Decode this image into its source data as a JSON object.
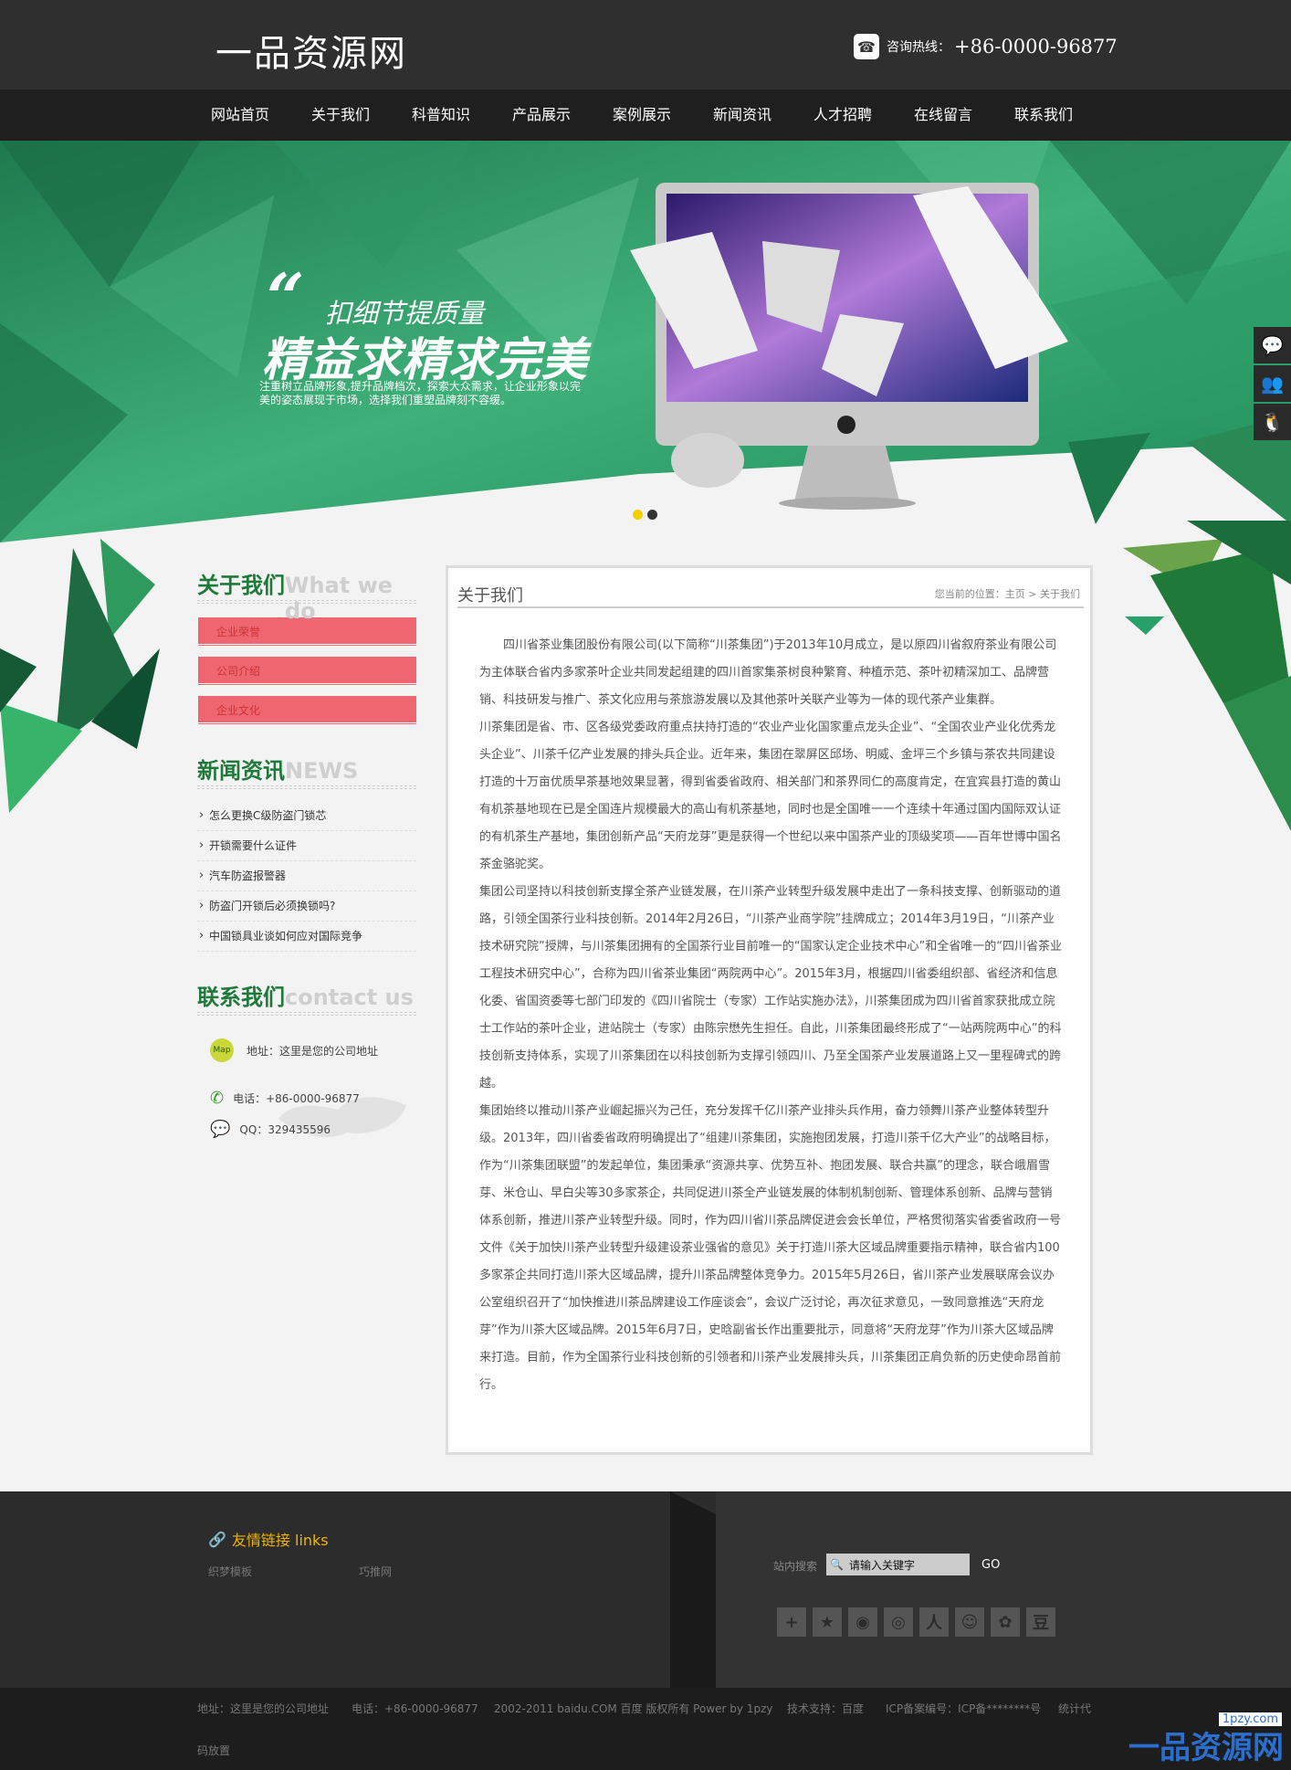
{
  "header": {
    "logo": "一品资源网",
    "hotline_label": "咨询热线：",
    "hotline_number": "+86-0000-96877"
  },
  "nav": [
    "网站首页",
    "关于我们",
    "科普知识",
    "产品展示",
    "案例展示",
    "新闻资讯",
    "人才招聘",
    "在线留言",
    "联系我们"
  ],
  "banner": {
    "quote": "“",
    "slogan_small": "扣细节提质量",
    "slogan_big": "精益求精求完美",
    "desc": "注重树立品牌形象,提升品牌档次，探索大众需求，让企业形象以完美的姿态展现于市场，选择我们重塑品牌刻不容缓。"
  },
  "sidebar": {
    "about": {
      "title": "关于我们",
      "title_en": "What we do",
      "items": [
        "企业荣誉",
        "公司介绍",
        "企业文化"
      ]
    },
    "news": {
      "title": "新闻资讯",
      "title_en": "NEWS",
      "items": [
        "怎么更换C级防盗门锁芯",
        "开锁需要什么证件",
        "汽车防盗报警器",
        "防盗门开锁后必须换锁吗?",
        "中国锁具业谈如何应对国际竞争"
      ]
    },
    "contact": {
      "title": "联系我们",
      "title_en": "contact us",
      "map_badge": "Map",
      "address": "地址：这里是您的公司地址",
      "phone": "电话：+86-0000-96877",
      "qq": "QQ：329435596"
    }
  },
  "main": {
    "title": "关于我们",
    "breadcrumb": "您当前的位置：主页 > 关于我们",
    "paragraphs": [
      "四川省茶业集团股份有限公司(以下简称“川茶集团”)于2013年10月成立，是以原四川省叙府茶业有限公司为主体联合省内多家茶叶企业共同发起组建的四川首家集茶树良种繁育、种植示范、茶叶初精深加工、品牌营销、科技研发与推广、茶文化应用与茶旅游发展以及其他茶叶关联产业等为一体的现代茶产业集群。",
      "川茶集团是省、市、区各级党委政府重点扶持打造的“农业产业化国家重点龙头企业”、“全国农业产业化优秀龙头企业”、川茶千亿产业发展的排头兵企业。近年来，集团在翠屏区邱场、明威、金坪三个乡镇与茶农共同建设打造的十万亩优质早茶基地效果显著，得到省委省政府、相关部门和茶界同仁的高度肯定，在宜宾县打造的黄山有机茶基地现在已是全国连片规模最大的高山有机茶基地，同时也是全国唯一一个连续十年通过国内国际双认证的有机茶生产基地，集团创新产品“天府龙芽”更是获得一个世纪以来中国茶产业的顶级奖项——百年世博中国名茶金骆驼奖。",
      "集团公司坚持以科技创新支撑全茶产业链发展，在川茶产业转型升级发展中走出了一条科技支撑、创新驱动的道路，引领全国茶行业科技创新。2014年2月26日，“川茶产业商学院”挂牌成立；2014年3月19日，“川茶产业技术研究院”授牌，与川茶集团拥有的全国茶行业目前唯一的“国家认定企业技术中心”和全省唯一的“四川省茶业工程技术研究中心”，合称为四川省茶业集团“两院两中心”。2015年3月，根据四川省委组织部、省经济和信息化委、省国资委等七部门印发的《四川省院士（专家）工作站实施办法》，川茶集团成为四川省首家获批成立院士工作站的茶叶企业，进站院士（专家）由陈宗懋先生担任。自此，川茶集团最终形成了“一站两院两中心”的科技创新支持体系，实现了川茶集团在以科技创新为支撑引领四川、乃至全国茶产业发展道路上又一里程碑式的跨越。",
      "集团始终以推动川茶产业崛起振兴为己任，充分发挥千亿川茶产业排头兵作用，奋力领舞川茶产业整体转型升级。2013年，四川省委省政府明确提出了“组建川茶集团，实施抱团发展，打造川茶千亿大产业”的战略目标，作为“川茶集团联盟”的发起单位，集团秉承“资源共享、优势互补、抱团发展、联合共赢”的理念，联合峨眉雪芽、米仓山、早白尖等30多家茶企，共同促进川茶全产业链发展的体制机制创新、管理体系创新、品牌与营销体系创新，推进川茶产业转型升级。同时，作为四川省川茶品牌促进会会长单位，严格贯彻落实省委省政府一号文件《关于加快川茶产业转型升级建设茶业强省的意见》关于打造川茶大区域品牌重要指示精神，联合省内100多家茶企共同打造川茶大区域品牌，提升川茶品牌整体竞争力。2015年5月26日，省川茶产业发展联席会议办公室组织召开了“加快推进川茶品牌建设工作座谈会”，会议广泛讨论，再次征求意见，一致同意推选“天府龙芽”作为川茶大区域品牌。2015年6月7日，史晗副省长作出重要批示，同意将“天府龙芽”作为川茶大区域品牌来打造。目前，作为全国茶行业科技创新的引领者和川茶产业发展排头兵，川茶集团正肩负新的历史使命昂首前行。"
    ]
  },
  "footer": {
    "links_title": "友情链接 links",
    "links": [
      "织梦模板",
      "巧推网"
    ],
    "search_label": "站内搜索",
    "search_placeholder": "请输入关键字",
    "search_button": "GO",
    "share_icons": [
      "plus-icon",
      "star-icon",
      "weibo-icon",
      "tencent-icon",
      "renren-icon",
      "kaixin-icon",
      "qzone-icon",
      "douban-icon"
    ]
  },
  "bottom": {
    "address": "地址：这里是您的公司地址",
    "phone": "电话：+86-0000-96877",
    "copyright": "2002-2011 baidu.COM 百度 版权所有 Power by 1pzy",
    "support": "技术支持：百度",
    "icp": "ICP备案编号：ICP备********号",
    "stats": "统计代",
    "stats2": "码放置"
  },
  "watermark": {
    "big": "一品资源网",
    "small": "1pzy.com"
  },
  "colors": {
    "green": "#1f7a3a",
    "about_item": "#ee6670",
    "header": "#2f2f2f",
    "nav": "#1f1f1f"
  }
}
